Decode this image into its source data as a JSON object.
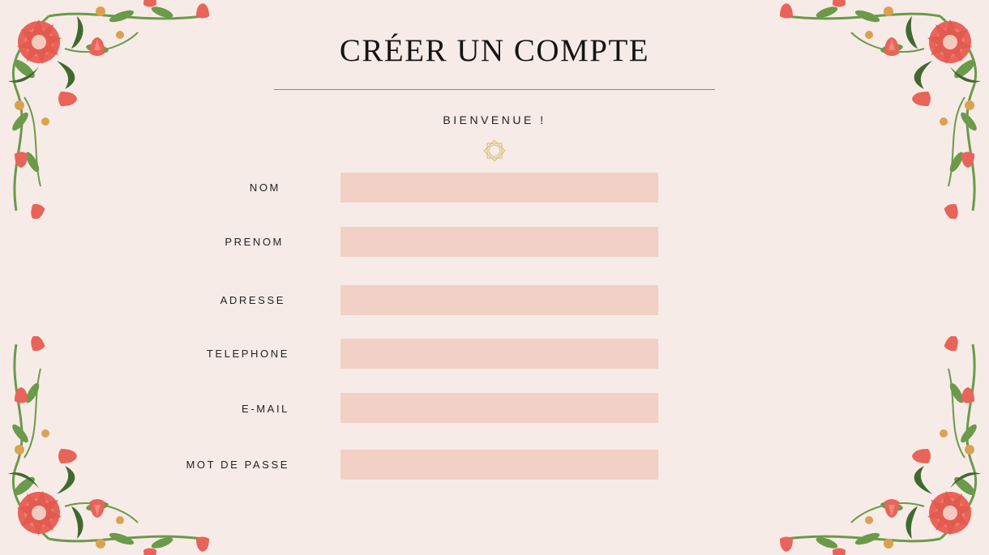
{
  "page": {
    "title": "CRÉER UN COMPTE",
    "subtitle": "BIENVENUE !"
  },
  "form": {
    "fields": [
      {
        "label": "NOM",
        "value": "",
        "placeholder": ""
      },
      {
        "label": "PRENOM",
        "value": "",
        "placeholder": ""
      },
      {
        "label": "ADRESSE",
        "value": "",
        "placeholder": ""
      },
      {
        "label": "TELEPHONE",
        "value": "",
        "placeholder": ""
      },
      {
        "label": "E-MAIL",
        "value": "",
        "placeholder": ""
      },
      {
        "label": "MOT DE PASSE",
        "value": "",
        "placeholder": ""
      }
    ]
  },
  "decor": {
    "corner_ornament": "floral-corner-icon",
    "center_ornament": "star-ornament-icon"
  },
  "colors": {
    "background": "#f7ebe7",
    "field": "#f2d0c5",
    "flower": "#e8645a",
    "leaf": "#6b9a4a",
    "dark_leaf": "#3f6a2f",
    "bud": "#d9a253"
  }
}
